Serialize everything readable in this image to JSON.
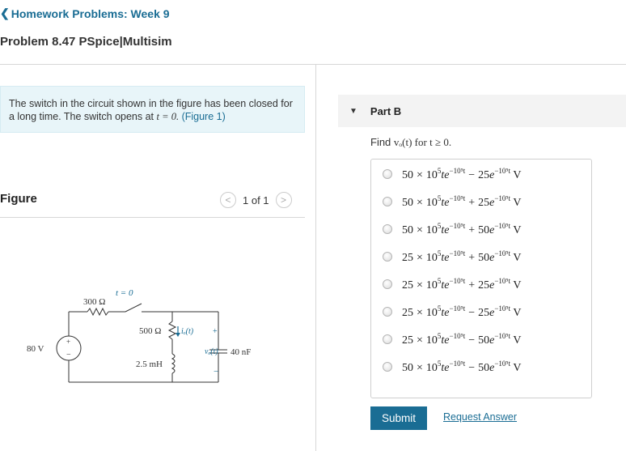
{
  "header": {
    "back_label": "Homework Problems: Week 9",
    "problem_title": "Problem 8.47 PSpice|Multisim"
  },
  "prompt": {
    "text": "The switch in the circuit shown in the figure has been closed for a long time. The switch opens at",
    "math": "t = 0.",
    "figure_link": "(Figure 1)"
  },
  "figure": {
    "label": "Figure",
    "pager": "1 of 1",
    "circuit": {
      "source": "80 V",
      "r1": "300 Ω",
      "switch": "t = 0",
      "r2": "500 Ω",
      "current": "iₒ(t)",
      "inductor": "2.5 mH",
      "voltage": "vₒ(t)",
      "capacitor": "40 nF",
      "plus": "+",
      "minus": "−"
    }
  },
  "part": {
    "label": "Part B",
    "question_prefix": "Find",
    "question_math": "vₒ(t) for t ≥ 0."
  },
  "choices": [
    {
      "coef": "50",
      "sign": "−",
      "amp2": "25"
    },
    {
      "coef": "50",
      "sign": "+",
      "amp2": "25"
    },
    {
      "coef": "50",
      "sign": "+",
      "amp2": "50"
    },
    {
      "coef": "25",
      "sign": "+",
      "amp2": "50"
    },
    {
      "coef": "25",
      "sign": "+",
      "amp2": "25"
    },
    {
      "coef": "25",
      "sign": "−",
      "amp2": "25"
    },
    {
      "coef": "25",
      "sign": "−",
      "amp2": "50"
    },
    {
      "coef": "50",
      "sign": "−",
      "amp2": "50"
    }
  ],
  "choice_units": {
    "times": "×",
    "base": "10",
    "exp": "5",
    "te": "te",
    "exp_text": "−10⁵t",
    "unit": "V"
  },
  "actions": {
    "submit": "Submit",
    "request": "Request Answer"
  },
  "colors": {
    "accent": "#1a6d94",
    "prompt_bg": "#e8f5f9"
  }
}
